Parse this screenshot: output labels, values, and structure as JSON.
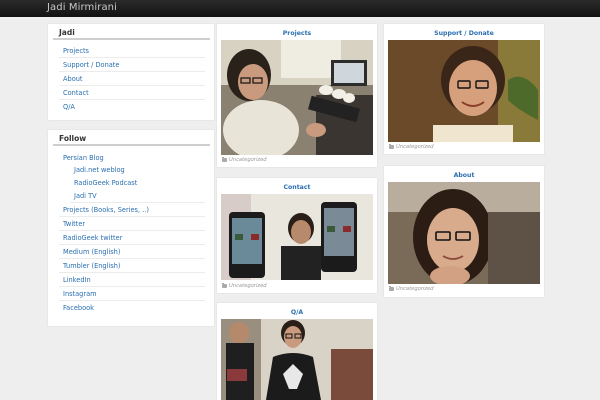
{
  "site": {
    "brand": "Jadi Mirmirani"
  },
  "sidebar": {
    "main_widget": {
      "title": "Jadi",
      "items": [
        "Projects",
        "Support / Donate",
        "About",
        "Contact",
        "Q/A"
      ]
    },
    "follow_widget": {
      "title": "Follow",
      "items": [
        "Persian Blog",
        "Jadi.net weblog",
        "RadioGeek Podcast",
        "Jadi TV",
        "Projects (Books, Series, ..)",
        "Twitter",
        "RadioGeek twitter",
        "Medium (English)",
        "Tumbler (English)",
        "LinkedIn",
        "Instagram",
        "Facebook"
      ]
    }
  },
  "posts": [
    {
      "title": "Projects",
      "category": "Uncategorized",
      "image": "man-at-computer-desk-photo"
    },
    {
      "title": "Support / Donate",
      "category": "Uncategorized",
      "image": "smiling-man-portrait-photo"
    },
    {
      "title": "Contact",
      "category": "Uncategorized",
      "image": "man-holding-two-phones-photo"
    },
    {
      "title": "About",
      "category": "Uncategorized",
      "image": "man-resting-chin-on-hand-photo"
    },
    {
      "title": "Q/A",
      "category": "",
      "image": "man-presenting-at-event-photo"
    }
  ]
}
